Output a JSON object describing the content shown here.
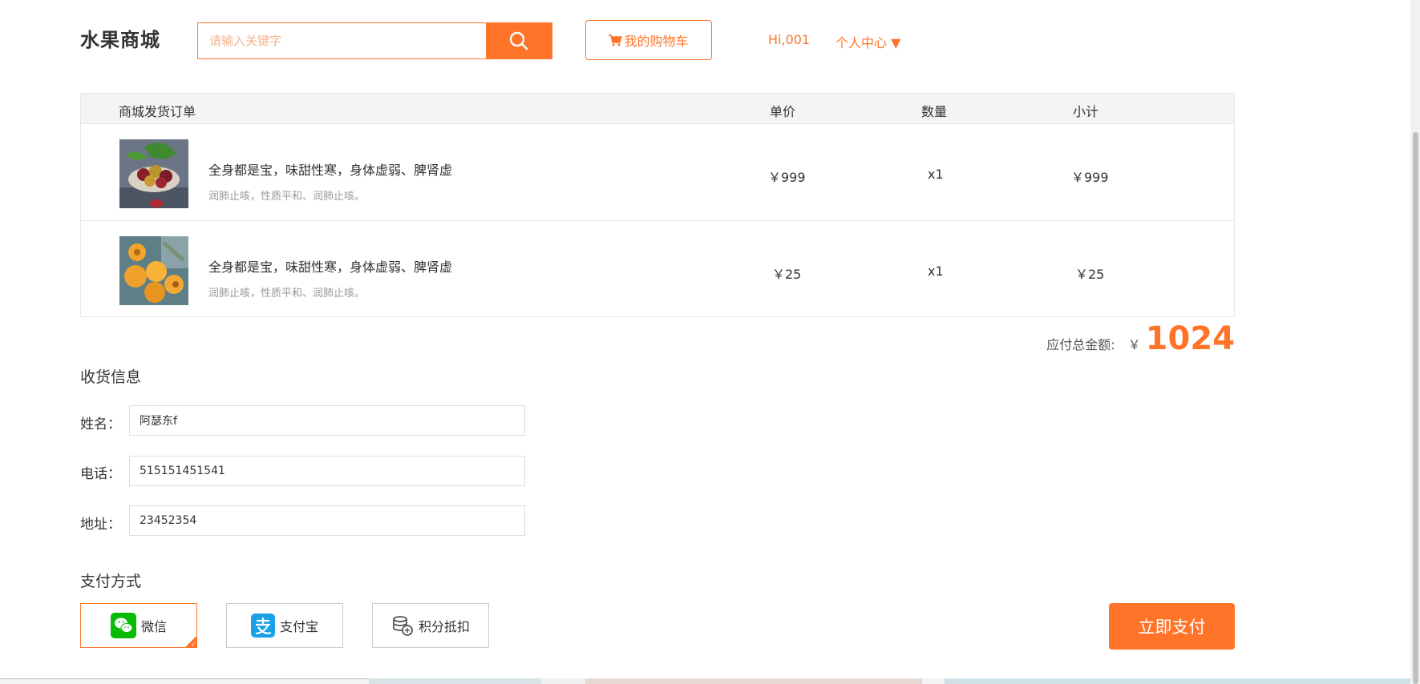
{
  "header": {
    "logo": "水果商城",
    "search_placeholder": "请输入关键字",
    "cart_label": "我的购物车",
    "greeting": "Hi,001",
    "user_center": "个人中心 ▼"
  },
  "order": {
    "columns": {
      "name": "商城发货订单",
      "price": "单价",
      "qty": "数量",
      "subtotal": "小计"
    },
    "items": [
      {
        "title": "全身都是宝，味甜性寒，身体虚弱、脾肾虚",
        "desc": "润肺止咳，性质平和、润肺止咳。",
        "price": "￥999",
        "qty": "x1",
        "subtotal": "￥999",
        "image": "plum-fruit-image"
      },
      {
        "title": "全身都是宝，味甜性寒，身体虚弱、脾肾虚",
        "desc": "润肺止咳，性质平和、润肺止咳。",
        "price": "￥25",
        "qty": "x1",
        "subtotal": "￥25",
        "image": "apricot-fruit-image"
      }
    ],
    "total_label": "应付总金额:",
    "total_currency": "￥",
    "total_amount": "1024"
  },
  "shipping": {
    "title": "收货信息",
    "name_label": "姓名：",
    "name_value": "阿瑟东f",
    "phone_label": "电话：",
    "phone_value": "515151451541",
    "address_label": "地址：",
    "address_value": "23452354"
  },
  "payment": {
    "title": "支付方式",
    "options": [
      {
        "label": "微信",
        "icon": "wechat-icon",
        "selected": true
      },
      {
        "label": "支付宝",
        "icon": "alipay-icon",
        "selected": false
      },
      {
        "label": "积分抵扣",
        "icon": "points-icon",
        "selected": false
      }
    ],
    "pay_button": "立即支付"
  },
  "colors": {
    "accent": "#ff7429",
    "wechat": "#09bb07",
    "alipay": "#1aa1e5"
  }
}
